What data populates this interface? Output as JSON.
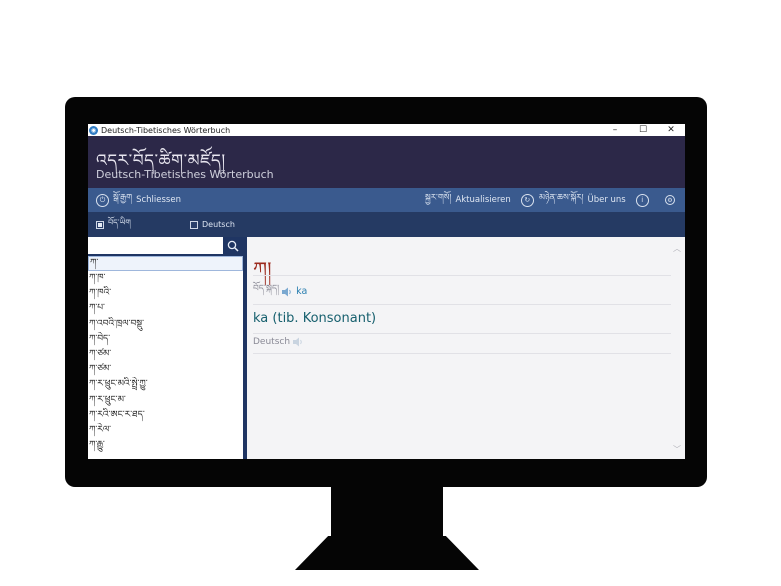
{
  "window": {
    "title": "Deutsch-Tibetisches Wörterbuch",
    "controls": {
      "minimize": "–",
      "maximize": "☐",
      "close": "✕"
    }
  },
  "header": {
    "title_tibetan": "འདར་བོད་ཚིག་མཛོད།",
    "subtitle": "Deutsch-Tibetisches Wörterbuch"
  },
  "toolbar": {
    "close_label_tib": "སྒོ་རྒྱག",
    "close_label": "Schliessen",
    "update_label_tib": "སྐྱར་གསོ།",
    "update_label": "Aktualisieren",
    "about_label_tib": "མཉེན་ཆས་སྐོར།",
    "about_label": "Über uns"
  },
  "language": {
    "options": [
      {
        "label": "བོད་ཡིག",
        "checked": true
      },
      {
        "label": "Deutsch",
        "checked": false
      }
    ]
  },
  "search": {
    "value": "",
    "placeholder": ""
  },
  "word_list": [
    "ཀ་",
    "ཀ་ཁ་",
    "ཀ་ཁའི་",
    "ཀ་པ་",
    "ཀ་འབའི་ཁྲལ་བསྡུ་",
    "ཀ་བེད་",
    "ཀ་ཙམ་",
    "ཀ་ཙམ་",
    "ཀ་ར་ཕྲུང་མའི་སྤྲེ་ཀྱུ་",
    "ཀ་ར་ཕྲུང་མ་",
    "ཀ་རའི་ཨང་ར་ཐད་",
    "ཀ་རེལ་",
    "ཀ་རྒྱུ་"
  ],
  "entry": {
    "headword": "ཀ།",
    "pron_label": "བོད་སྐད།",
    "pronunciation": "ka",
    "translation": "ka (tib. Konsonant)",
    "lang_label": "Deutsch"
  },
  "colors": {
    "header_bg": "#2c2848",
    "toolbar_bg": "#3a5a8e",
    "langbar_bg": "#253a63",
    "headword": "#9c2a1e",
    "translation": "#17606e",
    "pronunciation": "#2a7fb0"
  }
}
